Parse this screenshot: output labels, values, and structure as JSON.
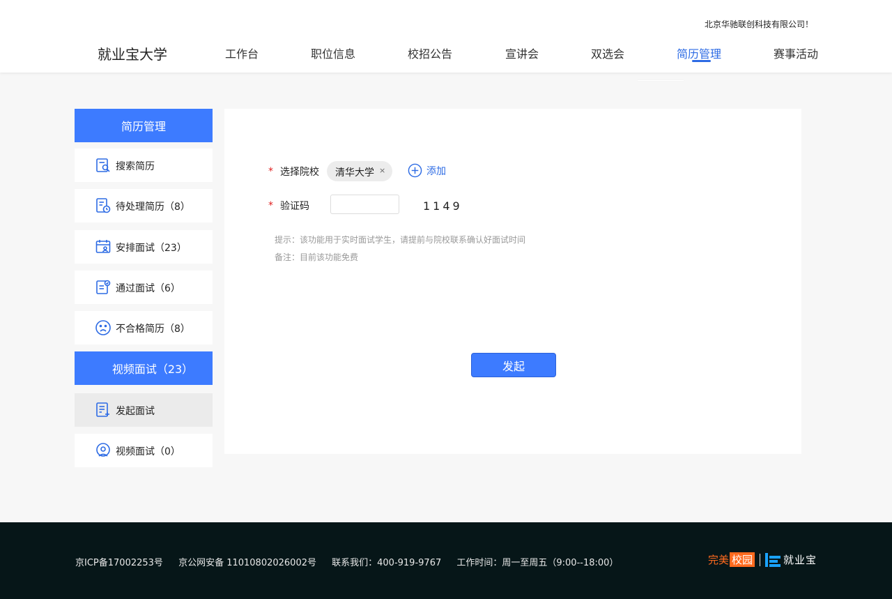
{
  "header": {
    "company": "北京华驰联创科技有限公司！",
    "logo": "就业宝大学",
    "nav": [
      {
        "label": "工作台"
      },
      {
        "label": "职位信息"
      },
      {
        "label": "校招公告"
      },
      {
        "label": "宣讲会"
      },
      {
        "label": "双选会"
      },
      {
        "label": "简历管理"
      },
      {
        "label": "赛事活动"
      }
    ]
  },
  "sidebar": {
    "section1": "简历管理",
    "items1": [
      {
        "label": "搜索简历"
      },
      {
        "label": "待处理简历（8）"
      },
      {
        "label": "安排面试（23）"
      },
      {
        "label": "通过面试（6）"
      },
      {
        "label": "不合格简历（8）"
      }
    ],
    "section2": "视频面试（23）",
    "items2": [
      {
        "label": "发起面试"
      },
      {
        "label": "视频面试（0）"
      }
    ]
  },
  "form": {
    "required_mark": "*",
    "school_label": "选择院校",
    "school_tag": "清华大学",
    "tag_close": "×",
    "add_label": "添加",
    "code_label": "验证码",
    "code_value": "",
    "captcha": "1149",
    "hint1": "提示：该功能用于实时面试学生，请提前与院校联系确认好面试时间",
    "hint2": "备注：目前该功能免费",
    "submit": "发起"
  },
  "footer": {
    "icp": "京ICP备17002253号",
    "police": "京公网安备 11010802026002号",
    "contact": "联系我们：400-919-9767",
    "hours": "工作时间：周一至周五（9:00--18:00）",
    "brand_a1": "完美",
    "brand_a2": "校园",
    "brand_b": "就业宝"
  },
  "colors": {
    "accent": "#3d7bff",
    "active_nav": "#2d6be4",
    "footer_bg": "#061618"
  }
}
